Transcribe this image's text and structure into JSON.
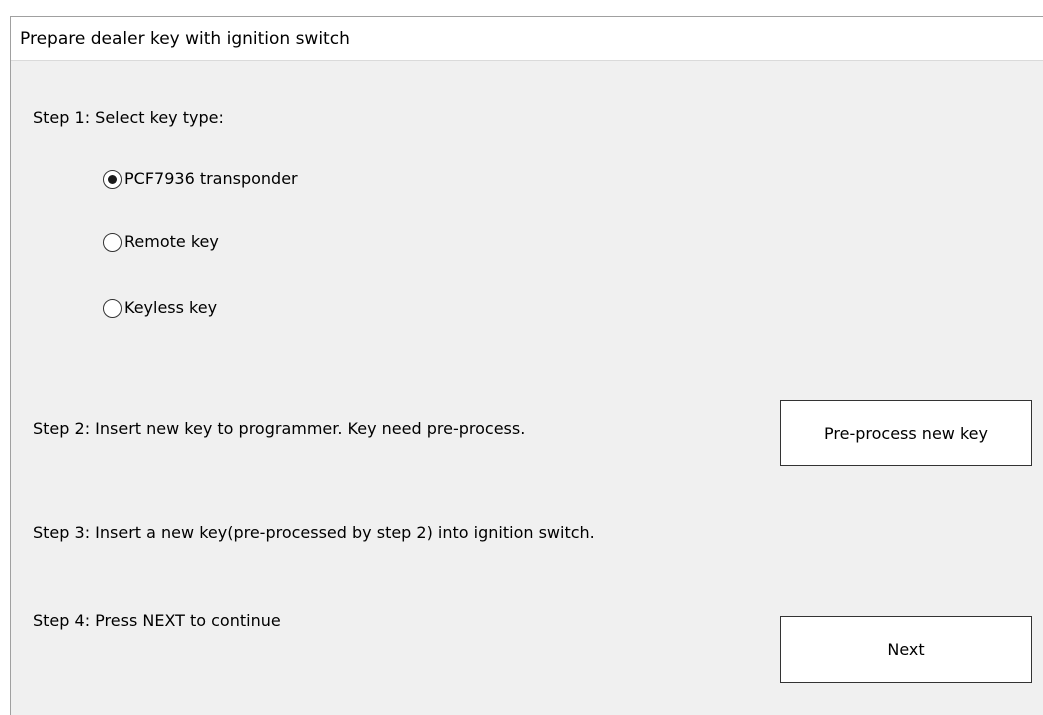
{
  "dialog": {
    "title": "Prepare dealer key with ignition switch"
  },
  "step1": {
    "label": "Step 1: Select key type:",
    "options": [
      {
        "label": "PCF7936 transponder",
        "checked": true
      },
      {
        "label": "Remote key",
        "checked": false
      },
      {
        "label": "Keyless key",
        "checked": false
      }
    ]
  },
  "step2": {
    "label": "Step 2: Insert new key to programmer. Key need pre-process.",
    "button_label": "Pre-process new key"
  },
  "step3": {
    "label": "Step 3: Insert a new key(pre-processed by step 2) into ignition switch."
  },
  "step4": {
    "label": "Step 4: Press NEXT to continue",
    "button_label": "Next"
  },
  "colors": {
    "dialog_background": "#f0f0f0",
    "title_background": "#ffffff",
    "button_background": "#ffffff",
    "border": "#333333"
  }
}
